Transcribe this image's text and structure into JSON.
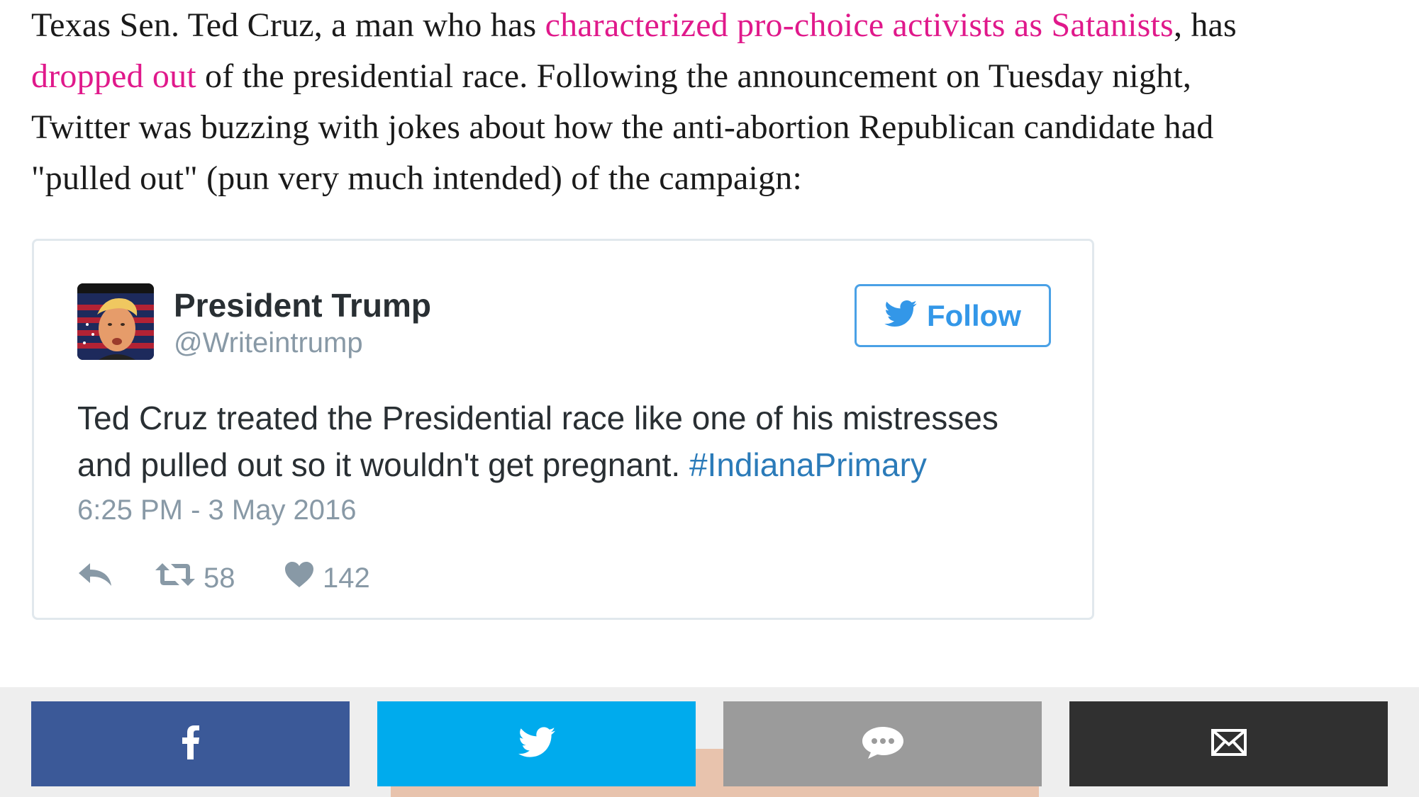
{
  "article": {
    "line1_before": "Texas Sen. Ted Cruz, a man who has ",
    "link1": "characterized pro-choice activists as Satanists",
    "line1_after": ", has",
    "link2": "dropped out",
    "line2_after": " of the presidential race. Following the announcement on Tuesday night,",
    "line3": "Twitter was buzzing with jokes about how the anti-abortion Republican candidate had",
    "line4": "\"pulled out\" (pun very much intended) of the campaign:",
    "link_color": "#e0198b"
  },
  "tweet": {
    "display_name": "President Trump",
    "handle": "@Writeintrump",
    "follow_label": "Follow",
    "text_line1": "Ted Cruz treated the Presidential race like one of his mistresses",
    "text_line2": "and pulled out so it wouldn't get pregnant. ",
    "hashtag": "#IndianaPrimary",
    "timestamp": "6:25 PM - 3 May 2016",
    "retweet_count": "58",
    "like_count": "142",
    "icons": [
      "reply-icon",
      "retweet-icon",
      "heart-icon",
      "twitter-bird-icon"
    ]
  },
  "share_bar": {
    "buttons": [
      {
        "name": "facebook",
        "icon": "facebook-icon",
        "color": "#3b5998"
      },
      {
        "name": "twitter",
        "icon": "twitter-bird-icon",
        "color": "#00abed"
      },
      {
        "name": "comment",
        "icon": "comment-bubble-icon",
        "color": "#9b9b9b"
      },
      {
        "name": "email",
        "icon": "envelope-icon",
        "color": "#303030"
      }
    ]
  }
}
